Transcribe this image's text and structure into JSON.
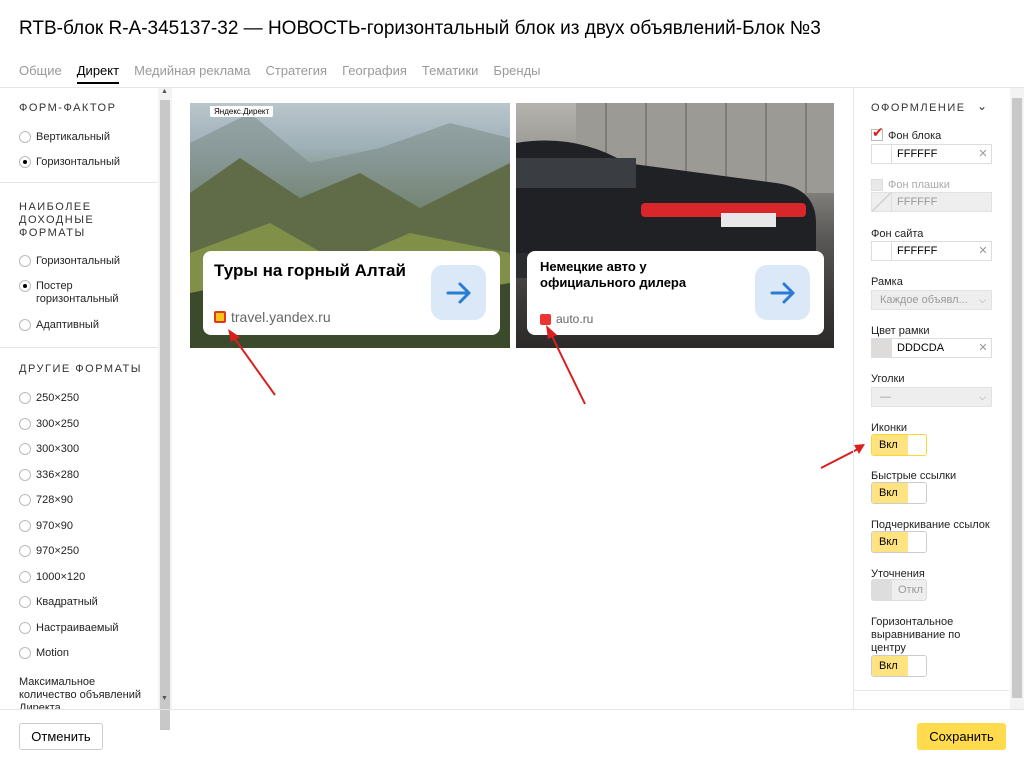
{
  "dialog": {
    "title": "RTB-блок R-A-345137-32 — НОВОСТЬ-горизонтальный блок из двух объявлений-Блок №3",
    "tabs": [
      "Общие",
      "Директ",
      "Медийная реклама",
      "Стратегия",
      "География",
      "Тематики",
      "Бренды"
    ],
    "active_tab": "Директ"
  },
  "left": {
    "form_factor": {
      "title": "ФОРМ-ФАКТОР",
      "options": [
        "Вертикальный",
        "Горизонтальный"
      ],
      "selected": "Горизонтальный"
    },
    "top_formats": {
      "title": "НАИБОЛЕЕ ДОХОДНЫЕ ФОРМАТЫ",
      "options": [
        "Горизонтальный",
        "Постер горизонтальный",
        "Адаптивный"
      ],
      "selected": "Постер горизонтальный"
    },
    "other_formats": {
      "title": "ДРУГИЕ ФОРМАТЫ",
      "options": [
        "250×250",
        "300×250",
        "300×300",
        "336×280",
        "728×90",
        "970×90",
        "970×250",
        "1000×120",
        "Квадратный",
        "Настраиваемый",
        "Motion"
      ]
    },
    "max_ads_label": "Максимальное количество объявлений Директа"
  },
  "preview": {
    "badge": "Яндекс.Директ",
    "ads": [
      {
        "title": "Туры на горный Алтай",
        "domain": "travel.yandex.ru"
      },
      {
        "title": "Немецкие авто у официального дилера",
        "domain": "auto.ru"
      }
    ]
  },
  "right": {
    "section_title": "ОФОРМЛЕНИЕ",
    "block_bg": {
      "label": "Фон блока",
      "value": "FFFFFF",
      "checked": true
    },
    "plate_bg": {
      "label": "Фон плашки",
      "value": "FFFFFF",
      "checked": false
    },
    "site_bg": {
      "label": "Фон сайта",
      "value": "FFFFFF"
    },
    "frame": {
      "label": "Рамка",
      "value": "Каждое объявл..."
    },
    "frame_color": {
      "label": "Цвет рамки",
      "value": "DDDCDA",
      "swatch": "#DDDCDA"
    },
    "corners": {
      "label": "Уголки",
      "value": "—"
    },
    "icons": {
      "label": "Иконки",
      "state": "Вкл"
    },
    "quick_links": {
      "label": "Быстрые ссылки",
      "state": "Вкл"
    },
    "link_underline": {
      "label": "Подчеркивание ссылок",
      "state": "Вкл"
    },
    "refinements": {
      "label": "Уточнения",
      "state": "Откл"
    },
    "horizontal_center": {
      "label": "Горизонтальное выравнивание по центру",
      "state": "Вкл"
    }
  },
  "footer": {
    "cancel": "Отменить",
    "save": "Сохранить"
  },
  "colors": {
    "accent": "#ffdb4d",
    "toggle_on": "#ffe380",
    "arrow": "#d9201f",
    "link_arrow_bg": "#dbe8f7"
  }
}
